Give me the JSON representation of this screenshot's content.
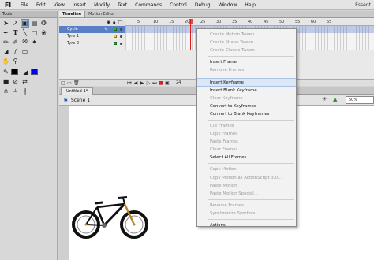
{
  "app": {
    "logo": "Fl",
    "user_label": "Essent"
  },
  "menubar": {
    "items": [
      "File",
      "Edit",
      "View",
      "Insert",
      "Modify",
      "Text",
      "Commands",
      "Control",
      "Debug",
      "Window",
      "Help"
    ]
  },
  "tools": {
    "title": "Tools",
    "icons": [
      "selection-icon",
      "subselection-icon",
      "free-transform-icon",
      "gradient-icon",
      "lasso-icon",
      "pen-icon",
      "text-icon",
      "line-icon",
      "rectangle-icon",
      "pencil-icon",
      "brush-icon",
      "ink-bottle-icon",
      "paint-bucket-icon",
      "eyedropper-icon",
      "eraser-icon",
      "hand-icon",
      "zoom-icon"
    ],
    "stroke_color": "#000000",
    "fill_color": "#0000ff"
  },
  "timeline": {
    "tabs": [
      "Timeline",
      "Motion Editor"
    ],
    "layers": [
      {
        "name": "Cycle",
        "selected": true
      },
      {
        "name": "Tyre 1",
        "selected": false
      },
      {
        "name": "Tyre 2",
        "selected": false
      }
    ],
    "ruler": [
      "5",
      "10",
      "15",
      "20",
      "25",
      "30",
      "35",
      "40",
      "45",
      "50",
      "55",
      "60",
      "65"
    ],
    "footer_value": "24"
  },
  "document": {
    "tab": "Untitled-1*",
    "scene": "Scene 1",
    "zoom": "50%"
  },
  "context_menu": {
    "items": [
      {
        "label": "Create Motion Tween",
        "disabled": true
      },
      {
        "label": "Create Shape Tween",
        "disabled": true
      },
      {
        "label": "Create Classic Tween",
        "disabled": true
      },
      {
        "sep": true
      },
      {
        "label": "Insert Frame",
        "disabled": false
      },
      {
        "label": "Remove Frames",
        "disabled": true
      },
      {
        "sep": true
      },
      {
        "label": "Insert Keyframe",
        "disabled": false,
        "hover": true
      },
      {
        "label": "Insert Blank Keyframe",
        "disabled": false
      },
      {
        "label": "Clear Keyframe",
        "disabled": true
      },
      {
        "label": "Convert to Keyframes",
        "disabled": false
      },
      {
        "label": "Convert to Blank Keyframes",
        "disabled": false
      },
      {
        "sep": true
      },
      {
        "label": "Cut Frames",
        "disabled": true
      },
      {
        "label": "Copy Frames",
        "disabled": true
      },
      {
        "label": "Paste Frames",
        "disabled": true
      },
      {
        "label": "Clear Frames",
        "disabled": true
      },
      {
        "label": "Select All Frames",
        "disabled": false
      },
      {
        "sep": true
      },
      {
        "label": "Copy Motion",
        "disabled": true
      },
      {
        "label": "Copy Motion as ActionScript 3.0...",
        "disabled": true
      },
      {
        "label": "Paste Motion",
        "disabled": true
      },
      {
        "label": "Paste Motion Special...",
        "disabled": true
      },
      {
        "sep": true
      },
      {
        "label": "Reverse Frames",
        "disabled": true
      },
      {
        "label": "Synchronize Symbols",
        "disabled": true
      },
      {
        "sep": true
      },
      {
        "label": "Actions",
        "disabled": false
      }
    ]
  }
}
